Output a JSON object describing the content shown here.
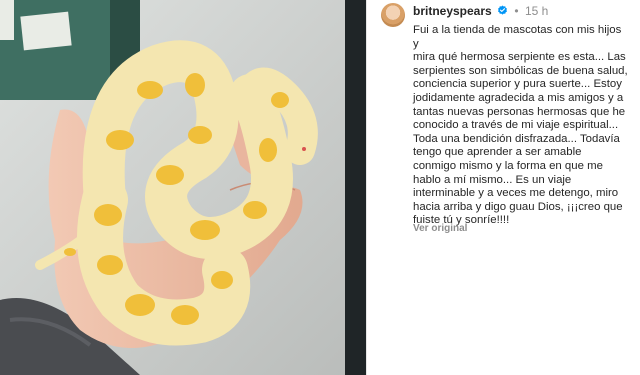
{
  "post": {
    "username": "britneyspears",
    "time_ago": "15 h",
    "separator": "•",
    "caption": "Fui a la tienda de mascotas con mis hijos y\nmira qué hermosa serpiente es esta... Las\nserpientes son simbólicas de buena salud,\nconciencia superior y pura suerte... Estoy\njodidamente agradecida a mis amigos y a\ntantas nuevas personas hermosas que he\nconocido a través de mi viaje espiritual...\nToda una bendición disfrazada... Todavía\ntengo que aprender a ser amable\nconmigo mismo y la forma en que me\nhablo a mí mismo... Es un viaje\ninterminable y a veces me detengo, miro\nhacia arriba y digo guau Dios, ¡¡¡creo que\nfuiste tú y sonríe!!!!",
    "see_original": "Ver original"
  },
  "photo": {
    "subject": "albino python held in hand",
    "snake_color": "#f4e6b0",
    "pattern_color": "#f0bf3a"
  },
  "icons": {
    "verified": "verified-badge-icon",
    "avatar": "profile-avatar"
  },
  "colors": {
    "verified_blue": "#0095f6",
    "text": "#262626",
    "muted": "#8e8e8e"
  }
}
